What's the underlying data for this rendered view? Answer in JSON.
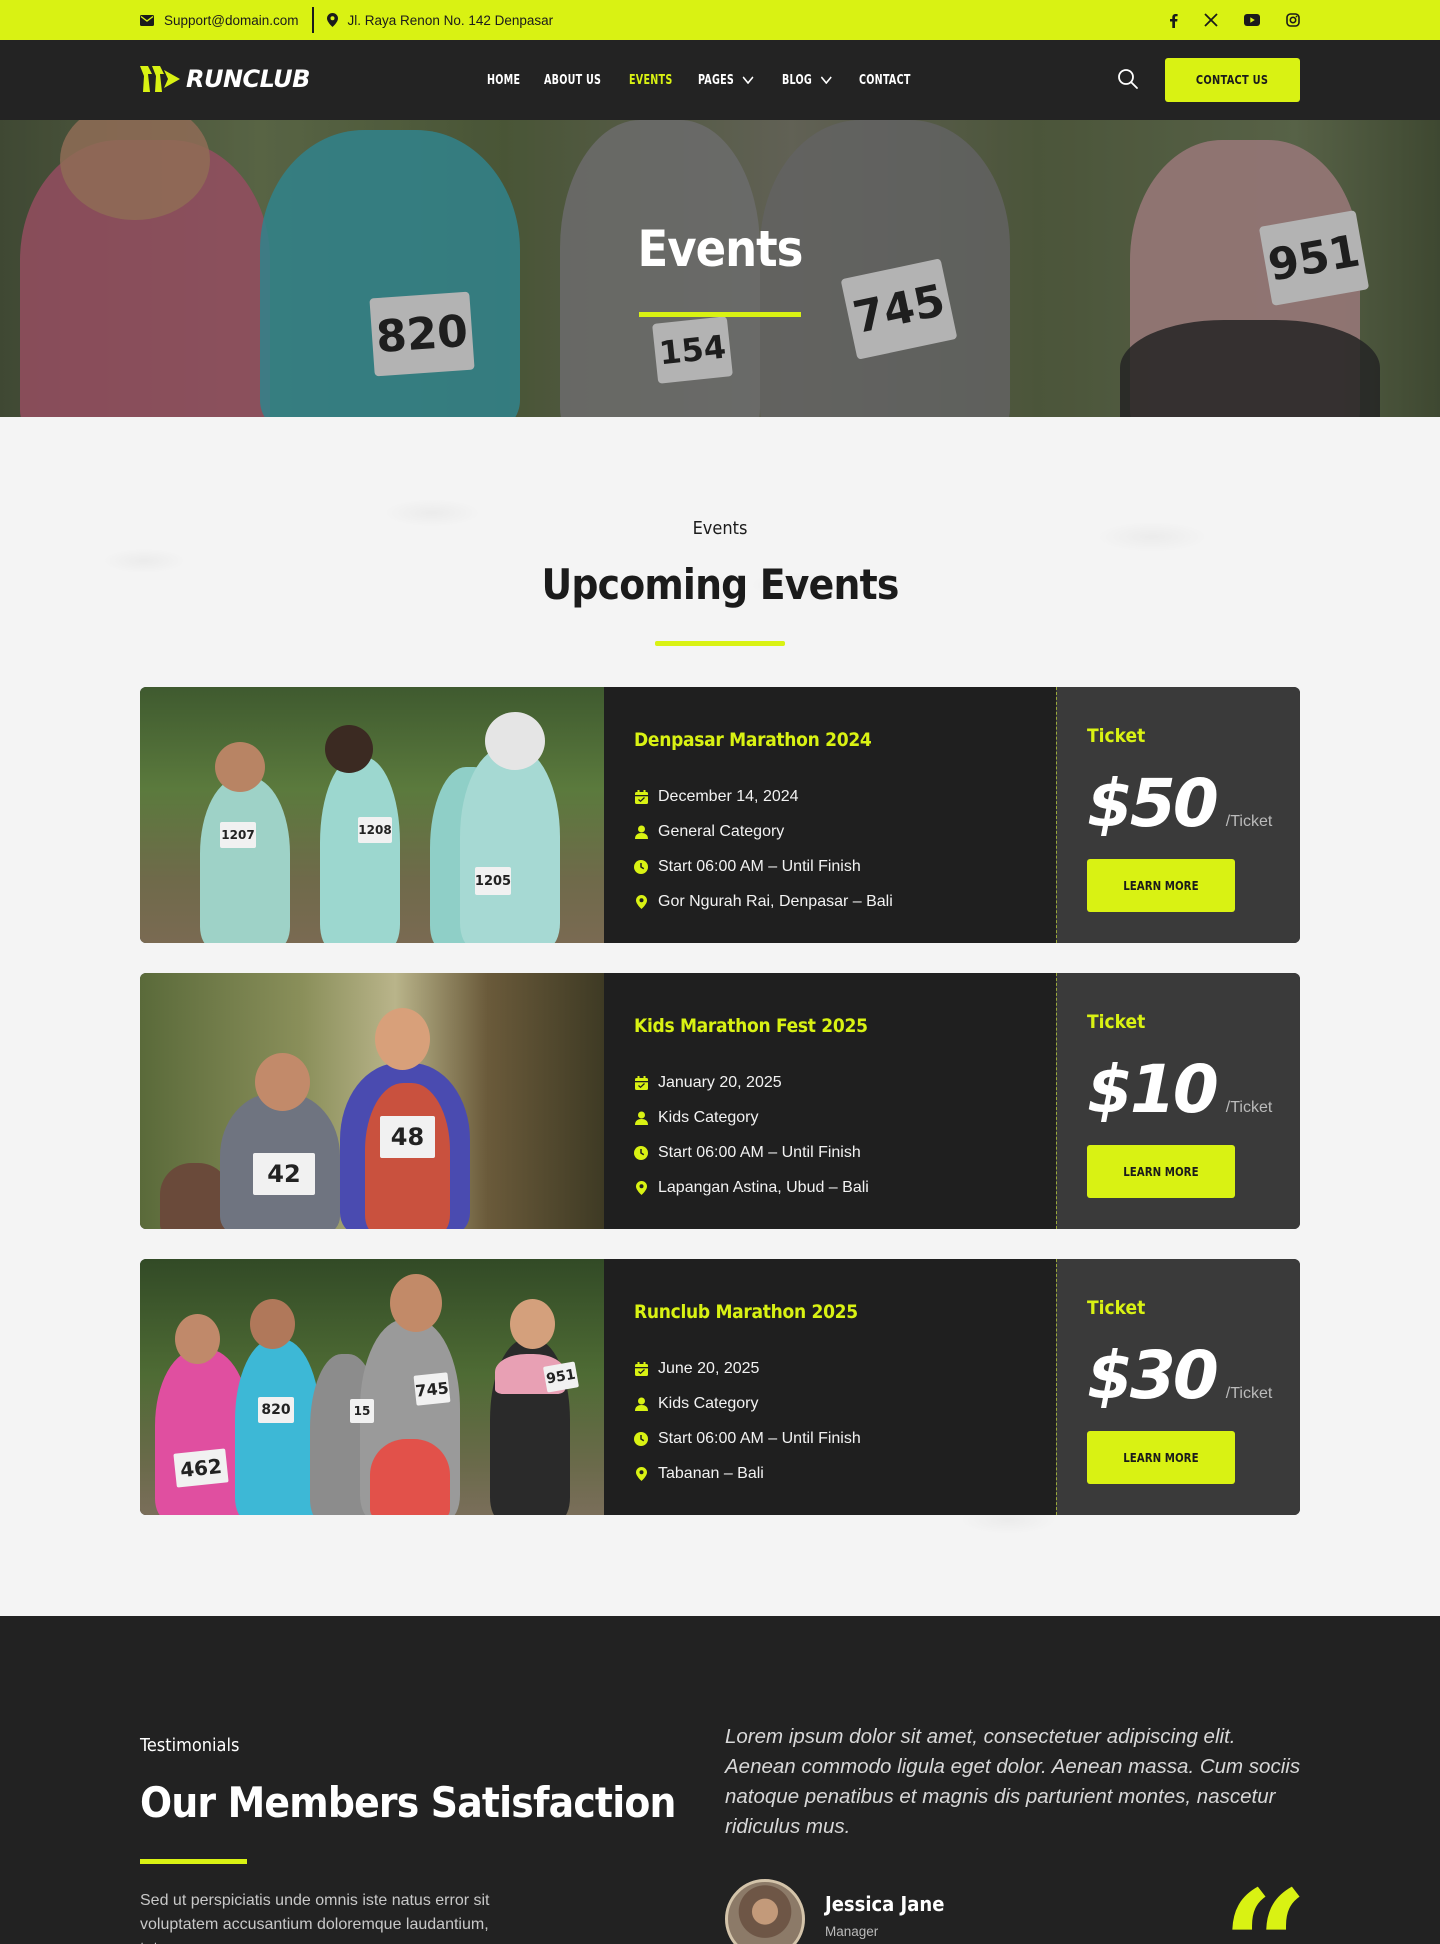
{
  "topbar": {
    "email": "Support@domain.com",
    "address": "Jl. Raya Renon No. 142 Denpasar",
    "social": [
      "facebook-icon",
      "x-twitter-icon",
      "youtube-icon",
      "instagram-icon"
    ]
  },
  "navbar": {
    "logo": "RUNCLUB",
    "items": [
      {
        "label": "HOME"
      },
      {
        "label": "ABOUT US"
      },
      {
        "label": "EVENTS",
        "active": true
      },
      {
        "label": "PAGES",
        "dropdown": true
      },
      {
        "label": "BLOG",
        "dropdown": true
      },
      {
        "label": "CONTACT"
      }
    ],
    "cta": "CONTACT US"
  },
  "hero": {
    "title": "Events",
    "bibs": [
      "820",
      "154",
      "745",
      "951"
    ]
  },
  "events_section": {
    "subtitle": "Events",
    "title": "Upcoming Events",
    "events": [
      {
        "title": "Denpasar Marathon 2024",
        "date": "December 14, 2024",
        "category": "General Category",
        "time": "Start 06:00 AM – Until Finish",
        "location": "Gor Ngurah Rai, Denpasar – Bali",
        "ticket_label": "Ticket",
        "price": "$50",
        "unit": "/Ticket",
        "button": "LEARN MORE",
        "bibs": [
          "1207",
          "1208",
          "1205"
        ]
      },
      {
        "title": "Kids Marathon Fest 2025",
        "date": "January 20, 2025",
        "category": "Kids Category",
        "time": "Start 06:00 AM – Until Finish",
        "location": "Lapangan Astina, Ubud – Bali",
        "ticket_label": "Ticket",
        "price": "$10",
        "unit": "/Ticket",
        "button": "LEARN MORE",
        "bibs": [
          "42",
          "48"
        ]
      },
      {
        "title": "Runclub Marathon 2025",
        "date": "June 20, 2025",
        "category": "Kids Category",
        "time": "Start 06:00 AM – Until Finish",
        "location": "Tabanan – Bali",
        "ticket_label": "Ticket",
        "price": "$30",
        "unit": "/Ticket",
        "button": "LEARN MORE",
        "bibs": [
          "462",
          "820",
          "15",
          "745",
          "951"
        ]
      }
    ]
  },
  "testimonials": {
    "subtitle": "Testimonials",
    "title": "Our Members Satisfaction",
    "text": "Sed ut perspiciatis unde omnis iste natus error sit voluptatem accusantium doloremque laudantium, totam",
    "quote": "Lorem ipsum dolor sit amet, consectetuer adipiscing elit. Aenean commodo ligula eget dolor. Aenean massa. Cum sociis natoque penatibus et magnis dis parturient montes, nascetur ridiculus mus.",
    "name": "Jessica Jane",
    "role": "Manager",
    "quote_mark": "“"
  },
  "colors": {
    "accent": "#d9f213",
    "dark": "#232323",
    "ticket_bg": "#3a3a3a"
  }
}
